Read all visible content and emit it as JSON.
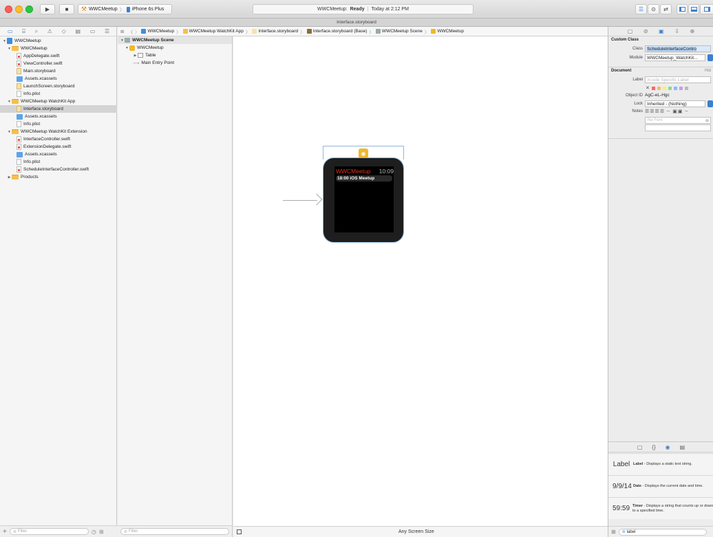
{
  "toolbar": {
    "scheme_name": "WWCMeetup",
    "device_name": "iPhone 6s Plus",
    "status_project": "WWCMeetup:",
    "status_state": "Ready",
    "status_time": "Today at 2:12 PM"
  },
  "tab_title": "Interface.storyboard",
  "navigator": {
    "items": [
      {
        "label": "WWCMeetup",
        "icon": "project-icon",
        "indent": 0,
        "disclosure": "open"
      },
      {
        "label": "WWCMeetup",
        "icon": "folder-icon",
        "indent": 1,
        "disclosure": "open"
      },
      {
        "label": "AppDelegate.swift",
        "icon": "swift-icon",
        "indent": 2,
        "disclosure": ""
      },
      {
        "label": "ViewController.swift",
        "icon": "swift-icon",
        "indent": 2,
        "disclosure": ""
      },
      {
        "label": "Main.storyboard",
        "icon": "storyboard-icon",
        "indent": 2,
        "disclosure": ""
      },
      {
        "label": "Assets.xcassets",
        "icon": "assets-icon",
        "indent": 2,
        "disclosure": ""
      },
      {
        "label": "LaunchScreen.storyboard",
        "icon": "storyboard-icon",
        "indent": 2,
        "disclosure": ""
      },
      {
        "label": "Info.plist",
        "icon": "plist-icon",
        "indent": 2,
        "disclosure": ""
      },
      {
        "label": "WWCMeetup WatchKit App",
        "icon": "folder-icon",
        "indent": 1,
        "disclosure": "open"
      },
      {
        "label": "Interface.storyboard",
        "icon": "storyboard-icon",
        "indent": 2,
        "disclosure": "",
        "selected": true
      },
      {
        "label": "Assets.xcassets",
        "icon": "assets-icon",
        "indent": 2,
        "disclosure": ""
      },
      {
        "label": "Info.plist",
        "icon": "plist-icon",
        "indent": 2,
        "disclosure": ""
      },
      {
        "label": "WWCMeetup WatchKit Extension",
        "icon": "folder-icon",
        "indent": 1,
        "disclosure": "open"
      },
      {
        "label": "InterfaceController.swift",
        "icon": "swift-icon",
        "indent": 2,
        "disclosure": ""
      },
      {
        "label": "ExtensionDelegate.swift",
        "icon": "swift-icon",
        "indent": 2,
        "disclosure": ""
      },
      {
        "label": "Assets.xcassets",
        "icon": "assets-icon",
        "indent": 2,
        "disclosure": ""
      },
      {
        "label": "Info.plist",
        "icon": "plist-icon",
        "indent": 2,
        "disclosure": ""
      },
      {
        "label": "ScheduleInterfaceController.swift",
        "icon": "swift-icon",
        "indent": 2,
        "disclosure": ""
      },
      {
        "label": "Products",
        "icon": "folder-icon",
        "indent": 1,
        "disclosure": "closed"
      }
    ],
    "filter_placeholder": "Filter"
  },
  "jumpbar": {
    "crumbs": [
      "WWCMeetup",
      "WWCMeetup WatchKit App",
      "Interface.storyboard",
      "Interface.storyboard (Base)",
      "WWCMeetup Scene",
      "WWCMeetup"
    ]
  },
  "outline": {
    "scene_title": "WWCMeetup Scene",
    "controller": "WWCMeetup",
    "table": "Table",
    "entry_point": "Main Entry Point",
    "filter_placeholder": "Filter"
  },
  "watch": {
    "title": "WWCMeetup",
    "time": "10:09",
    "row_text": "18:00  iOS Meetup",
    "title_color": "#e0321f"
  },
  "canvas": {
    "size_label": "Any Screen Size"
  },
  "inspector": {
    "custom_class_header": "Custom Class",
    "class_label": "Class",
    "class_value": "ScheduleInterfaceContro",
    "module_label": "Module",
    "module_value": "WWCMeetup_WatchKit...",
    "document_header": "Document",
    "hide_label": "Hid",
    "doc_label_label": "Label",
    "doc_label_placeholder": "Xcode Specific Label",
    "object_id_label": "Object ID",
    "object_id_value": "AgC-eL-Hgc",
    "lock_label": "Lock",
    "lock_value": "Inherited - (Nothing)",
    "notes_label": "Notes",
    "font_placeholder": "No Font"
  },
  "library": {
    "items": [
      {
        "icon_text": "Label",
        "title": "Label",
        "desc": " - Displays a static text string."
      },
      {
        "icon_text": "9/9/14",
        "title": "Date",
        "desc": " - Displays the current date and time."
      },
      {
        "icon_text": "59:59",
        "title": "Timer",
        "desc": " - Displays a string that counts up or down to a specified time."
      }
    ],
    "filter_value": "label"
  }
}
